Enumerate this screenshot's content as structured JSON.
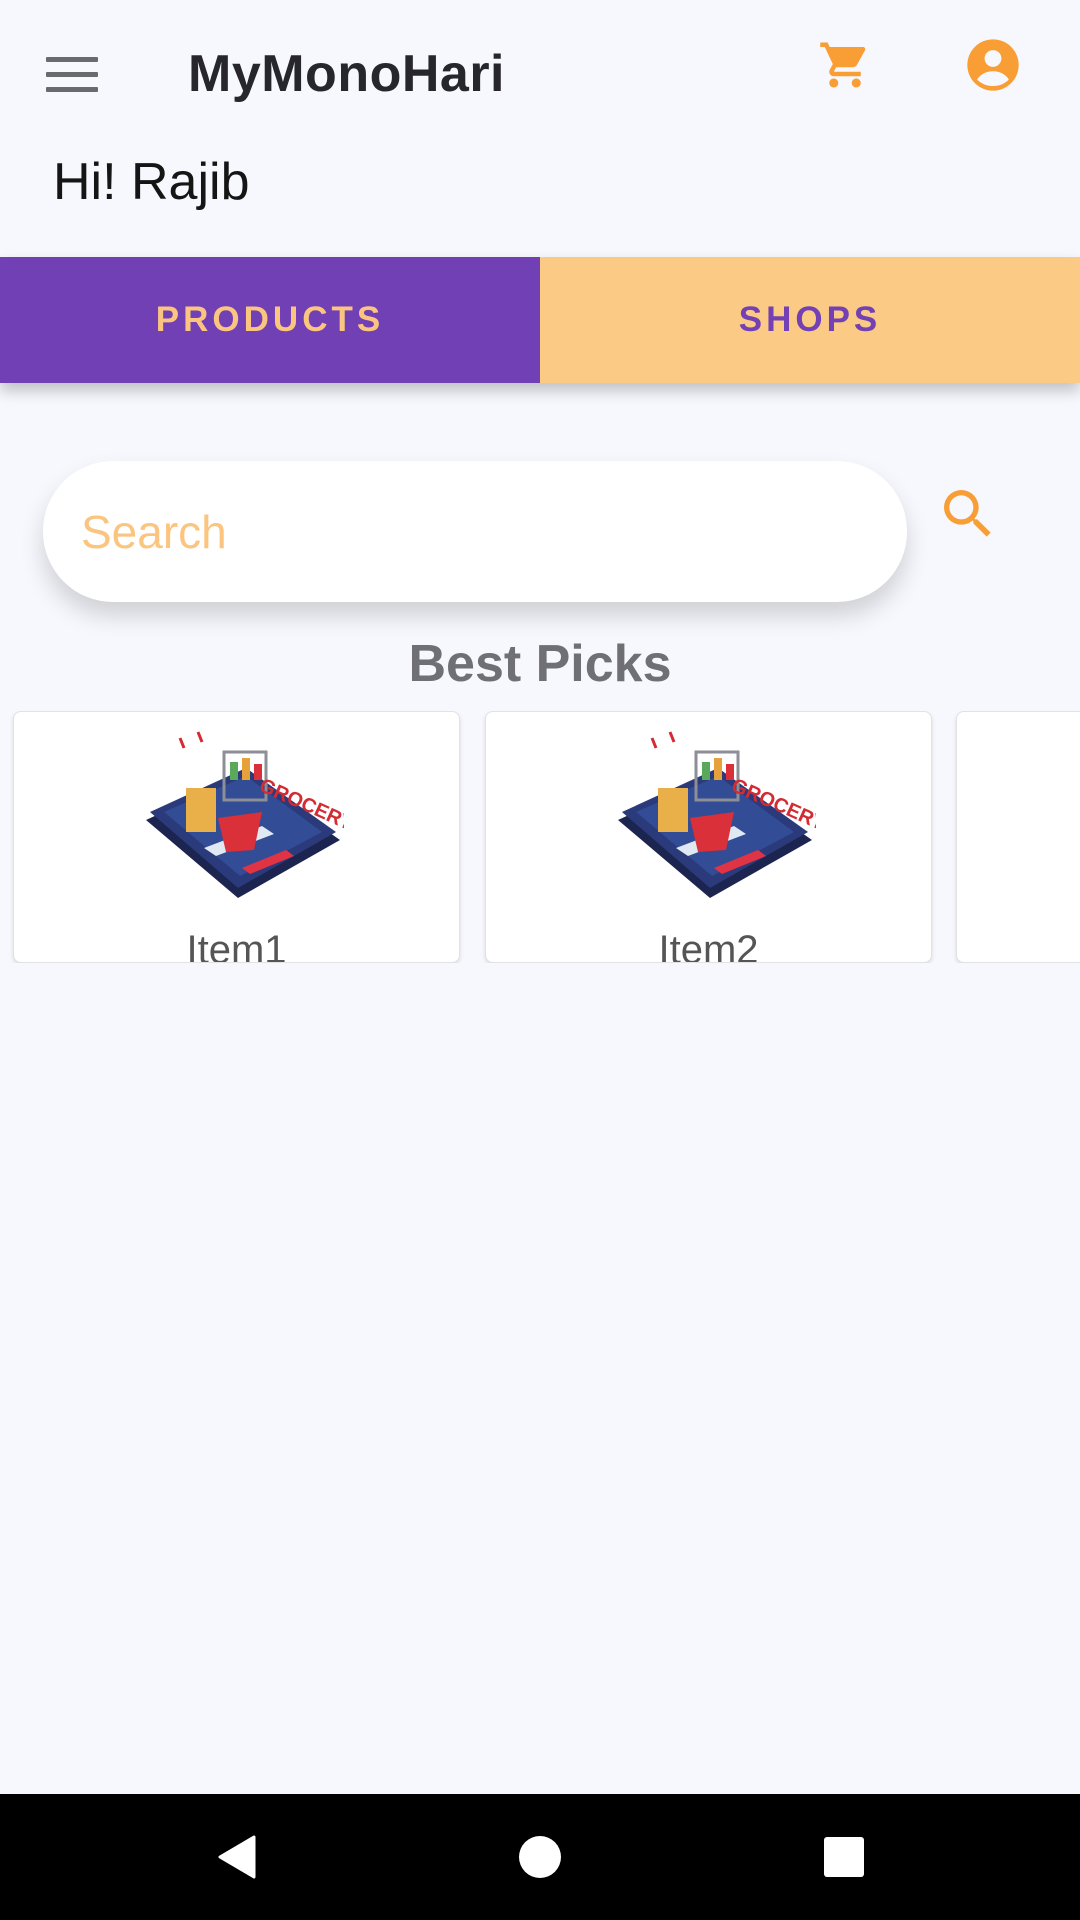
{
  "app": {
    "title": "MyMonoHari",
    "greeting": "Hi! Rajib",
    "accent_color": "#f99d35",
    "primary_color": "#7040b4",
    "secondary_color": "#fbca85"
  },
  "toolbar": {
    "menu_icon": "hamburger-menu-icon",
    "cart_icon": "shopping-cart-icon",
    "account_icon": "account-circle-icon"
  },
  "tabs": [
    {
      "label": "PRODUCTS",
      "selected": true
    },
    {
      "label": "SHOPS",
      "selected": false
    }
  ],
  "search": {
    "placeholder": "Search",
    "value": "",
    "icon": "search-icon"
  },
  "best_picks": {
    "title": "Best Picks",
    "items": [
      {
        "label": "Item1",
        "image": "grocery-phone-illustration"
      },
      {
        "label": "Item2",
        "image": "grocery-phone-illustration"
      },
      {
        "label": "",
        "image": ""
      }
    ]
  },
  "system_nav": {
    "back_icon": "back-triangle-icon",
    "home_icon": "home-circle-icon",
    "recents_icon": "recents-square-icon"
  }
}
